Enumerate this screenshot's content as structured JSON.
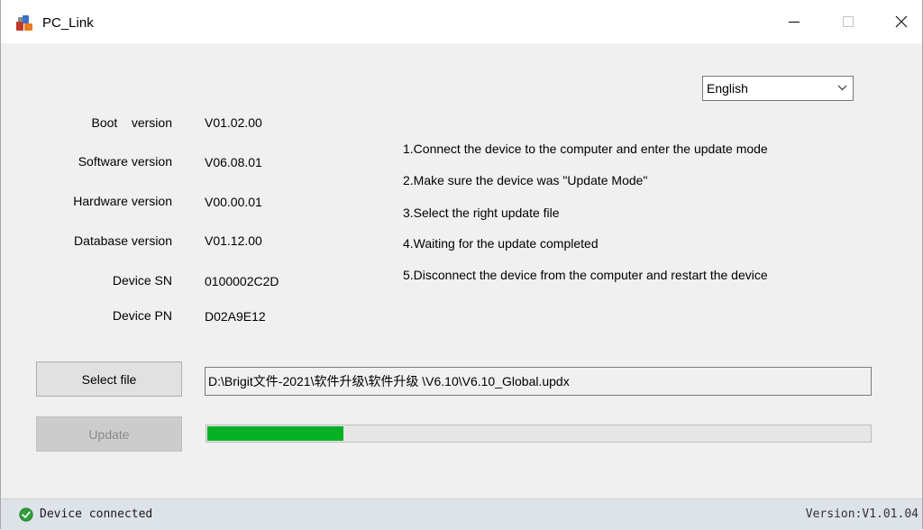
{
  "window": {
    "title": "PC_Link"
  },
  "language": {
    "selected": "English"
  },
  "device_info": [
    {
      "label": "Boot    version",
      "value": "V01.02.00"
    },
    {
      "label": "Software version",
      "value": "V06.08.01"
    },
    {
      "label": "Hardware version",
      "value": "V00.00.01"
    },
    {
      "label": "Database version",
      "value": "V01.12.00"
    },
    {
      "label": "Device SN",
      "value": "0100002C2D"
    },
    {
      "label": "Device PN",
      "value": "D02A9E12"
    }
  ],
  "steps": [
    "1.Connect the device to the computer and enter the update mode",
    "2.Make sure the device was \"Update Mode\"",
    "3.Select the right update file",
    "4.Waiting for the update completed",
    "5.Disconnect the device from the computer and restart the device"
  ],
  "actions": {
    "select_file_label": "Select file",
    "update_label": "Update"
  },
  "file": {
    "path": "D:\\Brigit文件-2021\\软件升级\\软件升级 \\V6.10\\V6.10_Global.updx"
  },
  "progress": {
    "percent": 20.5,
    "color": "#06b025"
  },
  "status": {
    "text": "Device connected",
    "version": "Version:V1.01.04",
    "ok_color": "#2e9e3a"
  }
}
